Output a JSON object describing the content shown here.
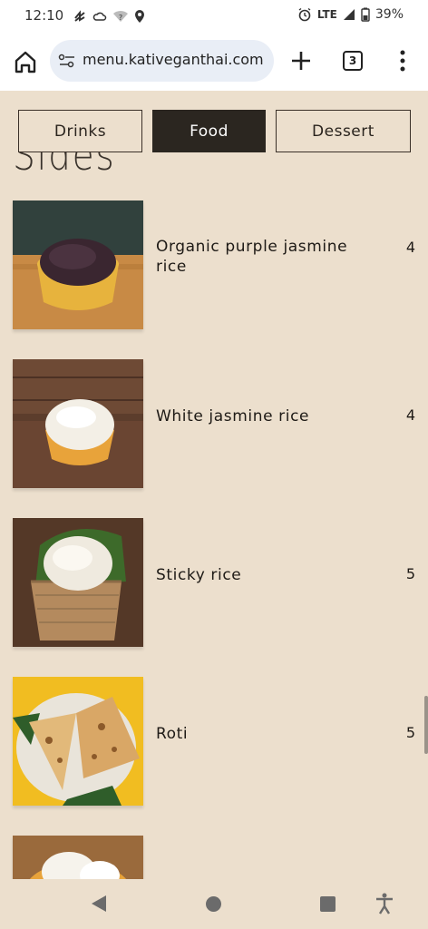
{
  "status_bar": {
    "time": "12:10",
    "network": "LTE",
    "battery": "39%",
    "icons": [
      "data-saver-icon",
      "cloud-icon",
      "wifi-question-icon",
      "location-icon",
      "alarm-icon",
      "signal-icon",
      "battery-icon"
    ]
  },
  "browser": {
    "url": "menu.kativeganthai.com",
    "tab_count": "3",
    "icons": [
      "home-icon",
      "site-settings-icon",
      "new-tab-plus-icon",
      "tab-switcher-icon",
      "more-vert-icon"
    ]
  },
  "categories": {
    "tabs": [
      {
        "label": "Drinks",
        "active": false
      },
      {
        "label": "Food",
        "active": true
      },
      {
        "label": "Dessert",
        "active": false
      }
    ]
  },
  "section": {
    "heading": "Sides"
  },
  "items": [
    {
      "name": "Organic purple jasmine rice",
      "price": "4",
      "image": "purple-rice-photo"
    },
    {
      "name": "White jasmine rice",
      "price": "4",
      "image": "white-rice-photo"
    },
    {
      "name": "Sticky rice",
      "price": "5",
      "image": "sticky-rice-photo"
    },
    {
      "name": "Roti",
      "price": "5",
      "image": "roti-photo"
    },
    {
      "name": "",
      "price": "",
      "image": "coconut-dessert-photo"
    }
  ],
  "nav_bar": {
    "icons": [
      "back-icon",
      "home-circle-icon",
      "recents-icon",
      "accessibility-icon"
    ]
  }
}
